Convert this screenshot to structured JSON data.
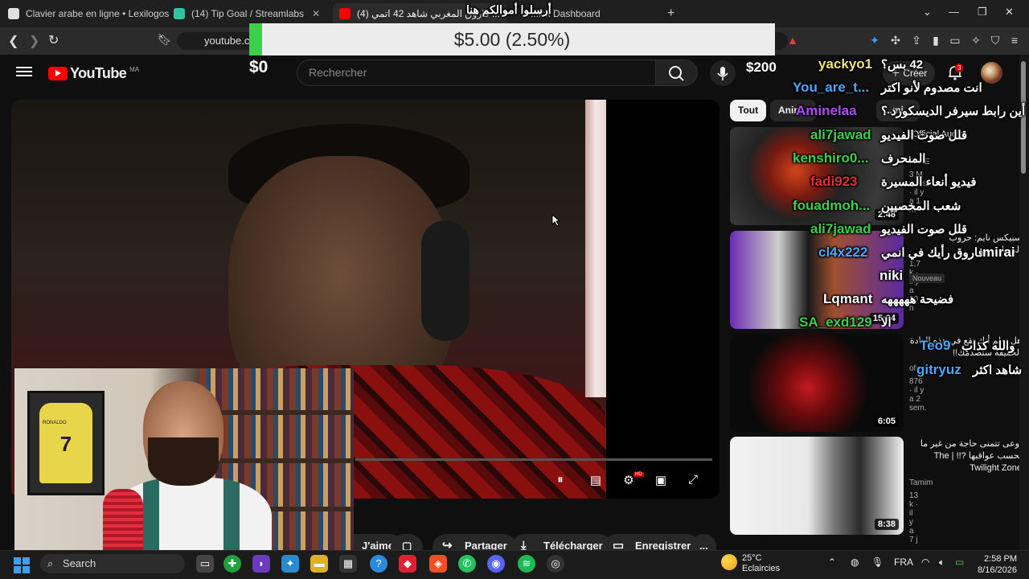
{
  "browser": {
    "tabs": [
      {
        "label": "Clavier arabe en ligne • Lexilogos",
        "color": "#e0e0e0"
      },
      {
        "label": "(14) Tip Goal / Streamlabs",
        "color": "#31c3a2"
      },
      {
        "label": "فاروق المغربي شاهد 42 اتمي (4) ...",
        "color": "#ff0000"
      },
      {
        "label": "...ick Dashboard",
        "color": "#7b5cff"
      }
    ],
    "url": "youtube.co",
    "new_tab": "+"
  },
  "donation_goal": {
    "label": "$5.00 (2.50%)",
    "progress_percent": 2.5,
    "start_amount": "$0",
    "goal_amount": "$200",
    "fill_color": "#3ad04a"
  },
  "youtube": {
    "logo_text": "YouTube",
    "country_code": "MA",
    "search_placeholder": "Rechercher",
    "create_label": "Créer",
    "notification_count": "3"
  },
  "player": {
    "controls": [
      "pause-icon",
      "subtitles-icon",
      "settings-icon",
      "miniplayer-icon",
      "fullscreen-icon"
    ],
    "hd_badge": "HD"
  },
  "actions": [
    {
      "label": "J'aime",
      "icon": "like-icon"
    },
    {
      "label": "",
      "icon": "dislike-icon"
    },
    {
      "label": "Partager",
      "icon": "share-icon"
    },
    {
      "label": "Télécharger",
      "icon": "download-icon"
    },
    {
      "label": "Enregistrer",
      "icon": "save-icon"
    },
    {
      "label": "...",
      "icon": "more-icon"
    }
  ],
  "sidebar": {
    "chips": [
      {
        "label": "Tout",
        "selected": true
      },
      {
        "label": "Anin...",
        "selected": false
      },
      {
        "label": "...mi...",
        "selected": false
      }
    ],
    "recommendations": [
      {
        "title": "(Official Audio)",
        "channel": "FAKE",
        "meta": "3 M vues · il y a 1 m",
        "duration": "2:48",
        "badge": ""
      },
      {
        "title": "سبيكس نايم: حروب الرسامين....",
        "channel": "",
        "meta": "1,7 k · il y a 20 h",
        "duration": "15:24",
        "badge": "Nouveau"
      },
      {
        "title": "هل تعلم أنك تقع في هذه العادة الحقيقة ستصدمك!!",
        "channel": "ofe...",
        "meta": "876 · il y a 2 sem.",
        "duration": "6:05",
        "badge": ""
      },
      {
        "title": "اوعى تتمنى حاجة من غير ما تحسب عواقبها The | !!? Twilight Zone",
        "channel": "Tamim",
        "meta": "13 k · il y a 7 j",
        "duration": "8:38",
        "badge": ""
      }
    ]
  },
  "chat": [
    {
      "name": "yackyo1",
      "message": "42 بس؟",
      "name_color": "#f3e07a"
    },
    {
      "name": "You_are_t...",
      "message": "انت مصدوم لأنو اكتر",
      "name_color": "#4aa8ff"
    },
    {
      "name": "Aminelaa",
      "message": "أين رابط سيرفر الديسكورد ؟",
      "name_color": "#b04aff"
    },
    {
      "name": "ali7jawad",
      "message": "قلل صوت الفيديو",
      "name_color": "#3ad04a"
    },
    {
      "name": "kenshiro0...",
      "message": "المنحرف",
      "name_color": "#3ad04a"
    },
    {
      "name": "fadi923",
      "message": "فيديو أنعاء المسيرة",
      "name_color": "#e0303a"
    },
    {
      "name": "fouadmoh...",
      "message": "شعب المخصيين",
      "name_color": "#3ad04a"
    },
    {
      "name": "ali7jawad",
      "message": "قلل صوت الفيديو",
      "name_color": "#3ad04a"
    },
    {
      "name": "cl4x222",
      "message": "فاروق رأيك في انمي",
      "name_color": "#4aa8ff"
    },
    {
      "name": "mirai",
      "message": "",
      "name_color": "#ffffff"
    },
    {
      "name": "niki",
      "message": "",
      "name_color": "#ffffff"
    },
    {
      "name": "Lqmant",
      "message": "فضيحة هههههه",
      "name_color": "#ffffff"
    },
    {
      "name": "SA_exd129",
      "message": "الا",
      "name_color": "#3ad04a"
    },
    {
      "name": "Teo9",
      "message": "والله كذاب",
      "name_color": "#4aa8ff"
    },
    {
      "name": "gitryuz",
      "message": "شاهد اكثر",
      "name_color": "#4aa8ff"
    }
  ],
  "chat_header": "أرسلوا أموالكم هنا",
  "webcam": {
    "jersey_name": "RONALDO",
    "jersey_number": "7"
  },
  "taskbar": {
    "search_label": "Search",
    "weather_temp": "25°C",
    "weather_desc": "Eclaircies",
    "language": "FRA",
    "time": "2:58 PM",
    "date": "8/16/2026"
  }
}
